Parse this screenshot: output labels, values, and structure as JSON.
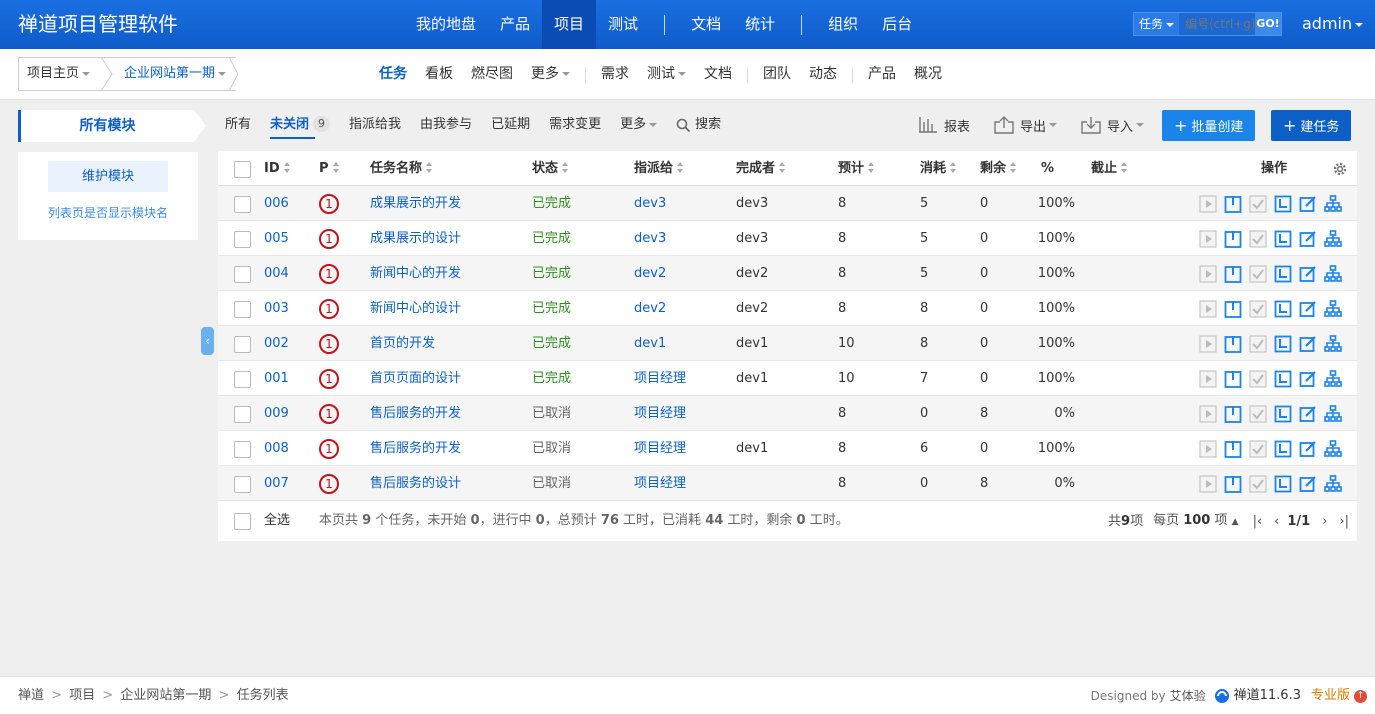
{
  "header": {
    "brand": "禅道项目管理软件",
    "nav": [
      "我的地盘",
      "产品",
      "项目",
      "测试",
      "文档",
      "统计",
      "组织",
      "后台"
    ],
    "active_nav": "项目",
    "search_type": "任务",
    "search_placeholder": "编号(ctrl+g)",
    "search_go": "GO!",
    "user": "admin"
  },
  "subheader": {
    "crumb_home": "项目主页",
    "crumb_project": "企业网站第一期",
    "nav": [
      "任务",
      "看板",
      "燃尽图",
      "更多",
      "需求",
      "测试",
      "文档",
      "团队",
      "动态",
      "产品",
      "概况"
    ],
    "active": "任务"
  },
  "sidebar": {
    "title": "所有模块",
    "maintain_button": "维护模块",
    "module_link": "列表页是否显示模块名"
  },
  "filters": {
    "items": [
      "所有",
      "未关闭",
      "指派给我",
      "由我参与",
      "已延期",
      "需求变更",
      "更多"
    ],
    "active": "未关闭",
    "active_count": "9",
    "search": "搜索"
  },
  "tools": {
    "report": "报表",
    "export": "导出",
    "import": "导入",
    "batch_create": "批量创建",
    "create_task": "建任务"
  },
  "table": {
    "columns": {
      "id": "ID",
      "pri": "P",
      "name": "任务名称",
      "status": "状态",
      "assigned": "指派给",
      "finished": "完成者",
      "estimate": "预计",
      "consumed": "消耗",
      "left": "剩余",
      "progress": "%",
      "deadline": "截止",
      "actions": "操作"
    },
    "rows": [
      {
        "id": "006",
        "pri": "1",
        "name": "成果展示的开发",
        "status": "已完成",
        "assigned": "dev3",
        "finished": "dev3",
        "estimate": "8",
        "consumed": "5",
        "left": "0",
        "progress": "100%"
      },
      {
        "id": "005",
        "pri": "1",
        "name": "成果展示的设计",
        "status": "已完成",
        "assigned": "dev3",
        "finished": "dev3",
        "estimate": "8",
        "consumed": "5",
        "left": "0",
        "progress": "100%"
      },
      {
        "id": "004",
        "pri": "1",
        "name": "新闻中心的开发",
        "status": "已完成",
        "assigned": "dev2",
        "finished": "dev2",
        "estimate": "8",
        "consumed": "5",
        "left": "0",
        "progress": "100%"
      },
      {
        "id": "003",
        "pri": "1",
        "name": "新闻中心的设计",
        "status": "已完成",
        "assigned": "dev2",
        "finished": "dev2",
        "estimate": "8",
        "consumed": "8",
        "left": "0",
        "progress": "100%"
      },
      {
        "id": "002",
        "pri": "1",
        "name": "首页的开发",
        "status": "已完成",
        "assigned": "dev1",
        "finished": "dev1",
        "estimate": "10",
        "consumed": "8",
        "left": "0",
        "progress": "100%"
      },
      {
        "id": "001",
        "pri": "1",
        "name": "首页页面的设计",
        "status": "已完成",
        "assigned": "项目经理",
        "finished": "dev1",
        "estimate": "10",
        "consumed": "7",
        "left": "0",
        "progress": "100%"
      },
      {
        "id": "009",
        "pri": "1",
        "name": "售后服务的开发",
        "status": "已取消",
        "assigned": "项目经理",
        "finished": "",
        "estimate": "8",
        "consumed": "0",
        "left": "8",
        "progress": "0%"
      },
      {
        "id": "008",
        "pri": "1",
        "name": "售后服务的开发",
        "status": "已取消",
        "assigned": "项目经理",
        "finished": "dev1",
        "estimate": "8",
        "consumed": "6",
        "left": "0",
        "progress": "100%"
      },
      {
        "id": "007",
        "pri": "1",
        "name": "售后服务的设计",
        "status": "已取消",
        "assigned": "项目经理",
        "finished": "",
        "estimate": "8",
        "consumed": "0",
        "left": "8",
        "progress": "0%"
      }
    ],
    "select_all": "全选",
    "summary_parts": [
      "本页共 ",
      "9",
      " 个任务，未开始 ",
      "0",
      "，进行中 ",
      "0",
      "，总预计 ",
      "76",
      " 工时，已消耗 ",
      "44",
      " 工时，剩余 ",
      "0",
      " 工时。"
    ],
    "pager": {
      "total_prefix": "共 ",
      "total": "9",
      "total_suffix": " 项",
      "per_page_prefix": "每页 ",
      "per_page": "100",
      "per_page_suffix": " 项",
      "page": "1/1"
    }
  },
  "footer": {
    "breadcrumb": [
      "禅道",
      "项目",
      "企业网站第一期",
      "任务列表"
    ],
    "designed_by": "Designed by",
    "designer": "艾体验",
    "version": "禅道11.6.3",
    "edition": "专业版"
  },
  "colors": {
    "primary": "#0c60c5",
    "done": "#2f8f1f",
    "priority": "#c4121b"
  }
}
